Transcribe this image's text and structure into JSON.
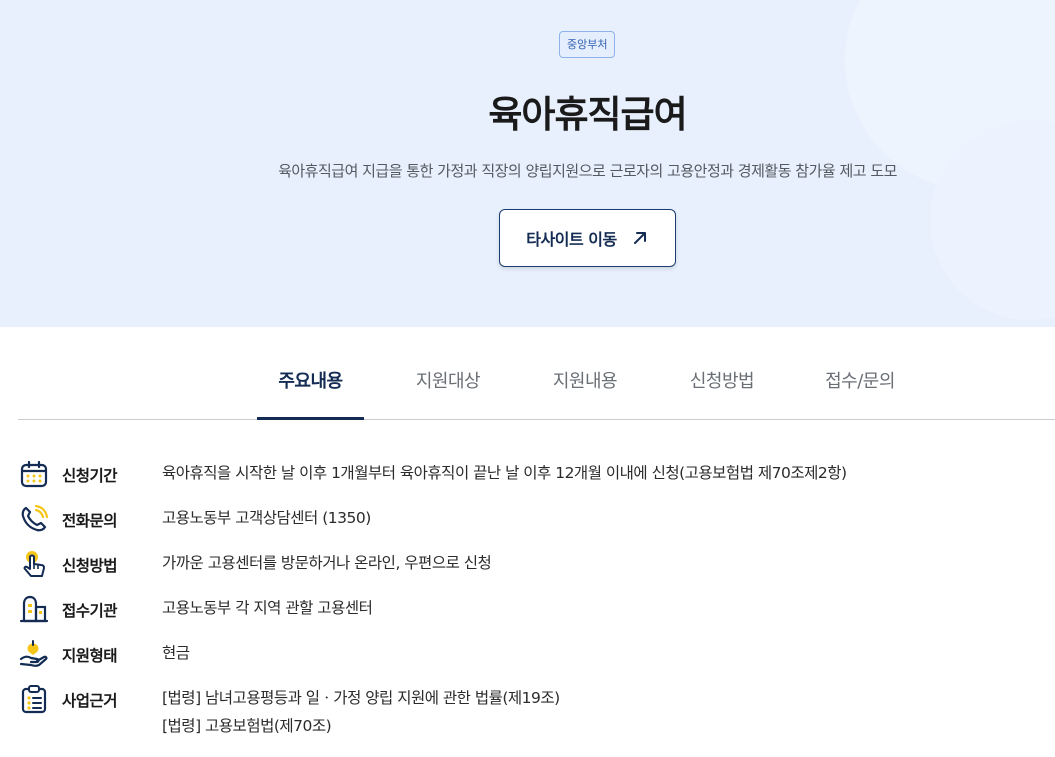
{
  "hero": {
    "badge": "중앙부처",
    "title": "육아휴직급여",
    "subtitle": "육아휴직급여 지급을 통한 가정과 직장의 양립지원으로 근로자의 고용안정과 경제활동 참가율 제고 도모",
    "site_button_label": "타사이트 이동",
    "site_button_icon": "arrow-up-right-icon"
  },
  "tabs": [
    {
      "label": "주요내용",
      "active": true
    },
    {
      "label": "지원대상",
      "active": false
    },
    {
      "label": "지원내용",
      "active": false
    },
    {
      "label": "신청방법",
      "active": false
    },
    {
      "label": "접수/문의",
      "active": false
    }
  ],
  "info_rows": [
    {
      "icon": "calendar-icon",
      "label": "신청기간",
      "value": "육아휴직을 시작한 날 이후 1개월부터 육아휴직이 끝난 날 이후 12개월 이내에 신청(고용보험법 제70조제2항)"
    },
    {
      "icon": "phone-icon",
      "label": "전화문의",
      "value": "고용노동부 고객상담센터 (1350)"
    },
    {
      "icon": "tap-hand-icon",
      "label": "신청방법",
      "value": "가까운 고용센터를 방문하거나 온라인, 우편으로 신청"
    },
    {
      "icon": "building-icon",
      "label": "접수기관",
      "value": "고용노동부 각 지역 관할 고용센터"
    },
    {
      "icon": "hand-money-icon",
      "label": "지원형태",
      "value": "현금"
    },
    {
      "icon": "clipboard-list-icon",
      "label": "사업근거",
      "value": "[법령] 남녀고용평등과 일ㆍ가정 양립 지원에 관한 법률(제19조)",
      "value2": "[법령] 고용보험법(제70조)"
    }
  ],
  "colors": {
    "hero_bg": "#e8f0fd",
    "navy": "#142c53",
    "icon_yellow": "#f5c518"
  }
}
